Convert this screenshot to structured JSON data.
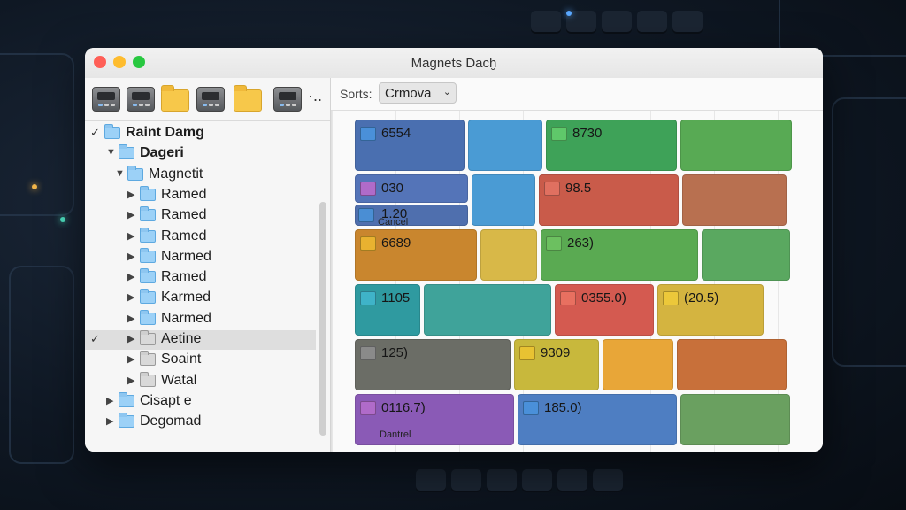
{
  "window": {
    "title": "Magnets Dacḫ"
  },
  "toolbar": {
    "icons": [
      "drive-icon",
      "drive-icon",
      "folder-icon",
      "drive-icon",
      "folder-icon",
      "drive-icon"
    ],
    "more": "·.."
  },
  "tree": {
    "items": [
      {
        "label": "Raint Damg",
        "level": 0,
        "expanded": true,
        "checked": true,
        "bold": true
      },
      {
        "label": "Dageri",
        "level": 1,
        "expanded": true,
        "bold": true
      },
      {
        "label": "Magnetit",
        "level": 2,
        "expanded": true
      },
      {
        "label": "Ramed",
        "level": 3
      },
      {
        "label": "Ramed",
        "level": 3
      },
      {
        "label": "Ramed",
        "level": 3
      },
      {
        "label": "Narmed",
        "level": 3
      },
      {
        "label": "Ramed",
        "level": 3
      },
      {
        "label": "Karmed",
        "level": 3
      },
      {
        "label": "Narmed",
        "level": 3
      },
      {
        "label": "Aetine",
        "level": 3,
        "selected": true,
        "checked": true,
        "grey": true
      },
      {
        "label": "Soaint",
        "level": 3,
        "grey": true
      },
      {
        "label": "Watal",
        "level": 3,
        "grey": true
      },
      {
        "label": "Cisapt e",
        "level": 1
      },
      {
        "label": "Degomad",
        "level": 1
      }
    ]
  },
  "sort": {
    "label": "Sorts:",
    "value": "Crmova",
    "caret": "⌄"
  },
  "rows": [
    {
      "blocks": [
        {
          "w": 128,
          "color": "#4a6fb0",
          "tile": "#4a90d9",
          "value": "6554"
        },
        {
          "w": 88,
          "color": "#4a9bd4"
        },
        {
          "w": 152,
          "color": "#3ea258",
          "tile": "#5fc86a",
          "value": "8730"
        },
        {
          "w": 130,
          "color": "#58aa54"
        }
      ]
    },
    {
      "blocks": [
        {
          "w": 132,
          "color": "#5474b8",
          "tile": "#b06bc9",
          "value": "030",
          "split": true
        },
        {
          "w": 76,
          "color": "#4a9bd4"
        },
        {
          "w": 162,
          "color": "#c95b4a",
          "tile": "#e07060",
          "value": "98.5"
        },
        {
          "w": 122,
          "color": "#b87050"
        }
      ],
      "second": {
        "tile": "#4a8ed4",
        "value": "1.20",
        "sub": "Cancel"
      }
    },
    {
      "blocks": [
        {
          "w": 142,
          "color": "#c9862e",
          "tile": "#e8b230",
          "value": "6689"
        },
        {
          "w": 68,
          "color": "#d8b848"
        },
        {
          "w": 182,
          "color": "#5aaa52",
          "tile": "#6cc060",
          "value": "263)"
        },
        {
          "w": 104,
          "color": "#5aa860"
        }
      ]
    },
    {
      "blocks": [
        {
          "w": 78,
          "color": "#2f9aa0",
          "tile": "#3fb3c8",
          "value": "1105"
        },
        {
          "w": 148,
          "color": "#3fa39a"
        },
        {
          "w": 116,
          "color": "#d45a50",
          "tile": "#e87060",
          "value": "0355.0)"
        },
        {
          "w": 124,
          "color": "#d4b440",
          "tile": "#ecc83a",
          "value": "(20.5)"
        }
      ]
    },
    {
      "blocks": [
        {
          "w": 180,
          "color": "#6b6d66",
          "tile": "#8a8a8a",
          "value": "125)"
        },
        {
          "w": 100,
          "color": "#c8b83c",
          "tile": "#e8c232",
          "value": "9309"
        },
        {
          "w": 84,
          "color": "#e8a638"
        },
        {
          "w": 128,
          "color": "#c8703a"
        }
      ]
    },
    {
      "blocks": [
        {
          "w": 184,
          "color": "#8a5ab6",
          "tile": "#b06bc9",
          "value": "0116.7)",
          "sub": "Dantrel"
        },
        {
          "w": 184,
          "color": "#4e7ec2",
          "tile": "#4a90d9",
          "value": "185.0)"
        },
        {
          "w": 128,
          "color": "#6aa060"
        }
      ]
    }
  ]
}
